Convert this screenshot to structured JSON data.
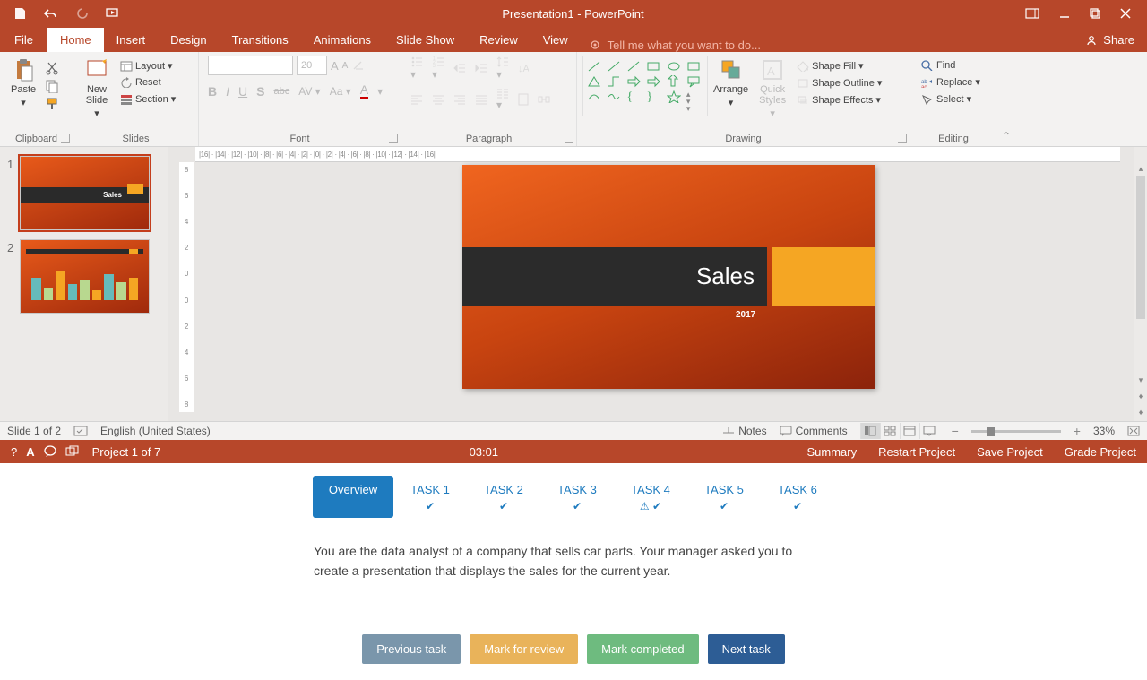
{
  "titlebar": {
    "title": "Presentation1 - PowerPoint"
  },
  "menu": {
    "file": "File",
    "home": "Home",
    "insert": "Insert",
    "design": "Design",
    "transitions": "Transitions",
    "animations": "Animations",
    "slideshow": "Slide Show",
    "review": "Review",
    "view": "View",
    "tellme": "Tell me what you want to do...",
    "share": "Share"
  },
  "ribbon": {
    "clipboard": {
      "label": "Clipboard",
      "paste": "Paste"
    },
    "slides": {
      "label": "Slides",
      "newslide": "New\nSlide",
      "layout": "Layout",
      "reset": "Reset",
      "section": "Section"
    },
    "font": {
      "label": "Font",
      "size": "20"
    },
    "paragraph": {
      "label": "Paragraph"
    },
    "drawing": {
      "label": "Drawing",
      "arrange": "Arrange",
      "quick": "Quick\nStyles",
      "fill": "Shape Fill",
      "outline": "Shape Outline",
      "effects": "Shape Effects"
    },
    "editing": {
      "label": "Editing",
      "find": "Find",
      "replace": "Replace",
      "select": "Select"
    }
  },
  "slide": {
    "title": "Sales",
    "year": "2017",
    "thumb1": "Sales"
  },
  "ruler": {
    "h": "|16| · |14| · |12| · |10| · |8| · |6| · |4| · |2| · |0| · |2| · |4| · |6| · |8| · |10| · |12| · |14| · |16|",
    "v8": "8",
    "v6": "6",
    "v4": "4",
    "v2": "2",
    "v0": "0"
  },
  "status": {
    "slide": "Slide 1 of 2",
    "lang": "English (United States)",
    "notes": "Notes",
    "comments": "Comments",
    "zoom": "33%"
  },
  "projbar": {
    "proj": "Project 1 of 7",
    "time": "03:01",
    "summary": "Summary",
    "restart": "Restart Project",
    "save": "Save Project",
    "grade": "Grade Project"
  },
  "tasks": {
    "overview": "Overview",
    "t1": "TASK 1",
    "t2": "TASK 2",
    "t3": "TASK 3",
    "t4": "TASK 4",
    "t5": "TASK 5",
    "t6": "TASK 6",
    "desc": "You are the data analyst of a company that sells car parts. Your manager asked you to create a presentation that displays the sales for the current year.",
    "prev": "Previous task",
    "mark": "Mark for review",
    "complete": "Mark completed",
    "next": "Next task"
  }
}
